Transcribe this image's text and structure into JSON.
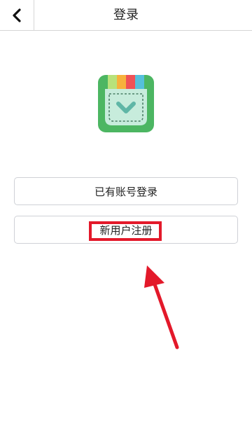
{
  "header": {
    "title": "登录",
    "back_icon": "chevron-left-icon"
  },
  "logo": {
    "icon": "app-logo-pocket-icon",
    "colors": {
      "background": "#4cb662",
      "stripes": [
        "#b8e27a",
        "#f7b13c",
        "#ef5257",
        "#55c0db"
      ],
      "pocket": "#c7ecdc",
      "chevron": "#5fb6a6"
    }
  },
  "buttons": {
    "login_label": "已有账号登录",
    "register_label": "新用户注册"
  },
  "annotation": {
    "color": "#e3192a",
    "type": "arrow-and-box",
    "target": "register"
  }
}
